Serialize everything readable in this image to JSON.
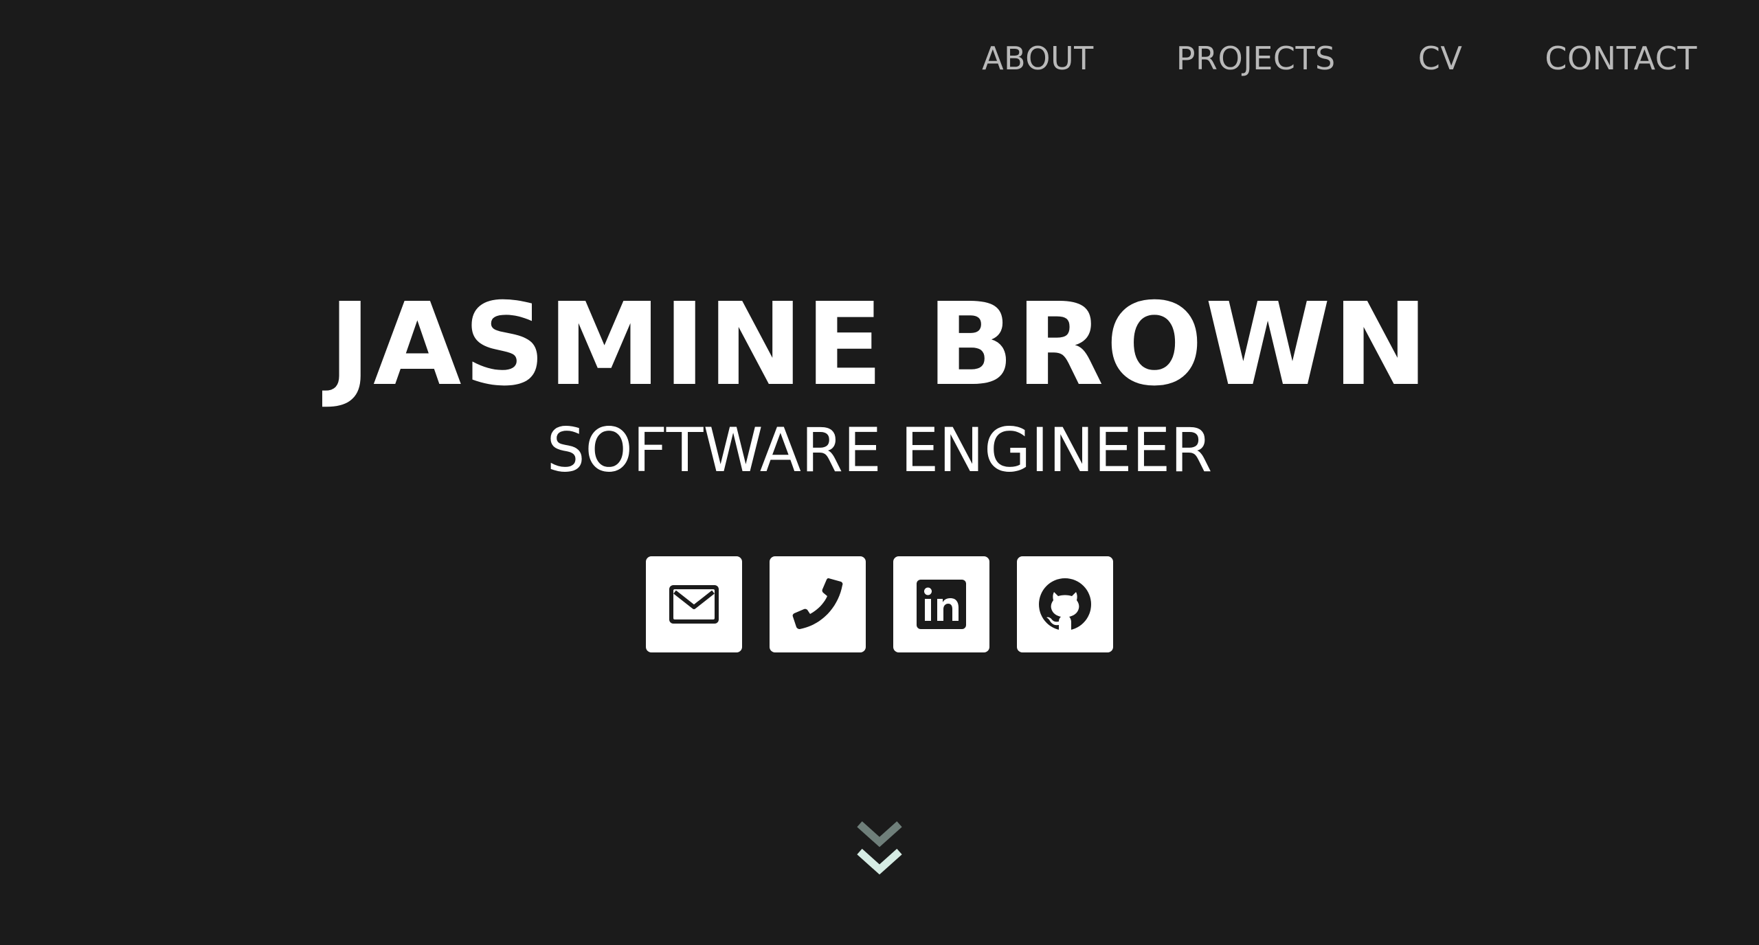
{
  "nav": {
    "items": [
      {
        "label": "ABOUT"
      },
      {
        "label": "PROJECTS"
      },
      {
        "label": "CV"
      },
      {
        "label": "CONTACT"
      }
    ]
  },
  "hero": {
    "name": "JASMINE BROWN",
    "role": "SOFTWARE ENGINEER"
  },
  "socials": [
    {
      "icon": "envelope-icon"
    },
    {
      "icon": "phone-icon"
    },
    {
      "icon": "linkedin-icon"
    },
    {
      "icon": "github-icon"
    }
  ],
  "scroll": {
    "icon": "double-chevron-down-icon"
  },
  "colors": {
    "background": "#1b1b1b",
    "nav_text": "#b9b9b9",
    "text": "#ffffff",
    "chevron_top": "#6f7f7a",
    "chevron_bottom": "#d6ece4"
  }
}
